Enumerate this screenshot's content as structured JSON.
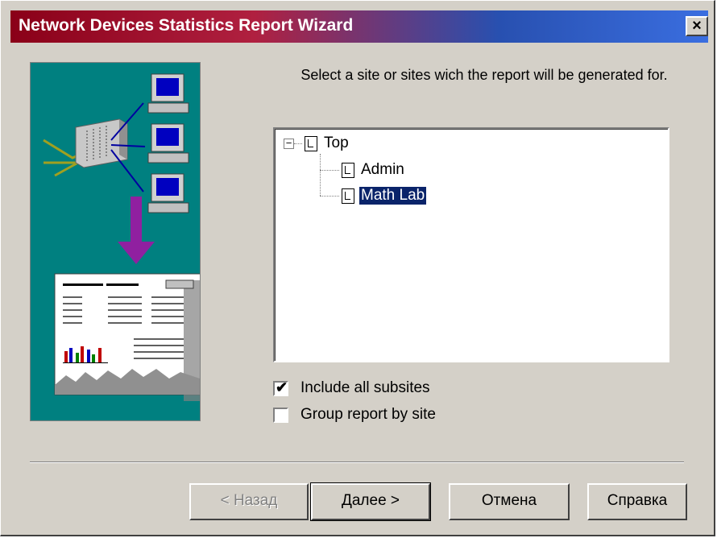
{
  "window": {
    "title": "Network Devices Statistics Report Wizard",
    "close_glyph": "×"
  },
  "bitmap": {
    "icon": "wizard-network-report-illustration",
    "background": "#008080"
  },
  "prompt": {
    "text": "Select a site or sites wich the report will be generated for."
  },
  "tree": {
    "expander_glyph": "−",
    "root": {
      "label": "Top"
    },
    "children": [
      {
        "label": "Admin",
        "selected": false
      },
      {
        "label": "Math Lab",
        "selected": true
      }
    ]
  },
  "options": {
    "include_subsites": {
      "label": "Include all subsites",
      "checked": true,
      "mark": "✔"
    },
    "group_by_site": {
      "label": "Group report by site",
      "checked": false
    }
  },
  "buttons": {
    "back": "< Назад",
    "next": "Далее >",
    "cancel": "Отмена",
    "help": "Справка"
  },
  "colors": {
    "selection": "#0a246a",
    "dialog": "#d4d0c8"
  }
}
